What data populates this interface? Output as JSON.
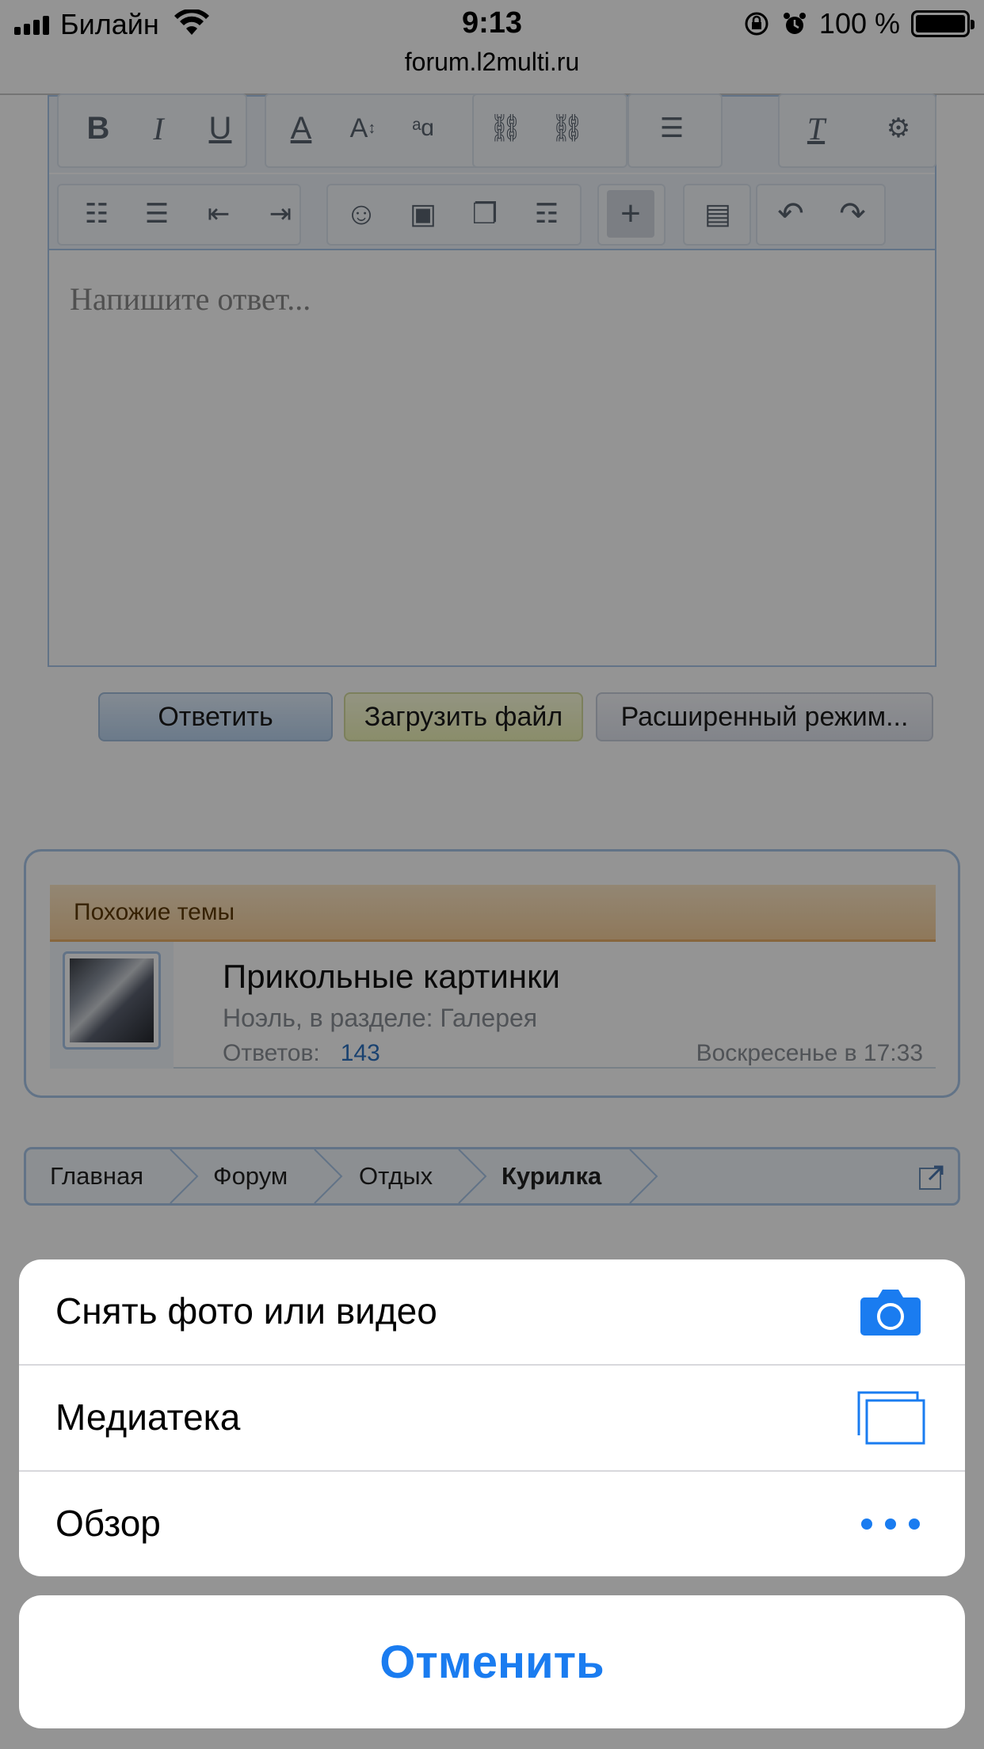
{
  "statusbar": {
    "carrier": "Билайн",
    "time": "9:13",
    "battery_percent": "100 %"
  },
  "browser": {
    "url": "forum.l2multi.ru"
  },
  "editor": {
    "placeholder": "Напишите ответ...",
    "toolbar_row1": [
      "bold-icon",
      "italic-icon",
      "underline-icon",
      "text-color-icon",
      "font-size-icon",
      "font-family-icon",
      "link-icon",
      "unlink-icon",
      "align-icon",
      "clear-format-icon",
      "toggle-source-icon"
    ],
    "toolbar_row2": [
      "bullet-list-icon",
      "numbered-list-icon",
      "outdent-icon",
      "indent-icon",
      "smiley-icon",
      "image-icon",
      "media-icon",
      "code-icon",
      "insert-more-icon",
      "save-draft-icon",
      "undo-icon",
      "redo-icon"
    ]
  },
  "actions": {
    "reply": "Ответить",
    "upload": "Загрузить файл",
    "advanced": "Расширенный режим..."
  },
  "similar_topics": {
    "header": "Похожие темы",
    "items": [
      {
        "title": "Прикольные картинки",
        "meta": "Ноэль, в разделе: Галерея",
        "replies_label": "Ответов:",
        "replies_count": "143",
        "date": "Воскресенье в 17:33"
      }
    ]
  },
  "breadcrumb": [
    "Главная",
    "Форум",
    "Отдых",
    "Курилка"
  ],
  "action_sheet": {
    "items": [
      {
        "label": "Снять фото или видео",
        "icon": "camera-icon"
      },
      {
        "label": "Медиатека",
        "icon": "photo-library-icon"
      },
      {
        "label": "Обзор",
        "icon": "more-icon"
      }
    ],
    "cancel": "Отменить",
    "accent_color": "#1a7cf0"
  }
}
